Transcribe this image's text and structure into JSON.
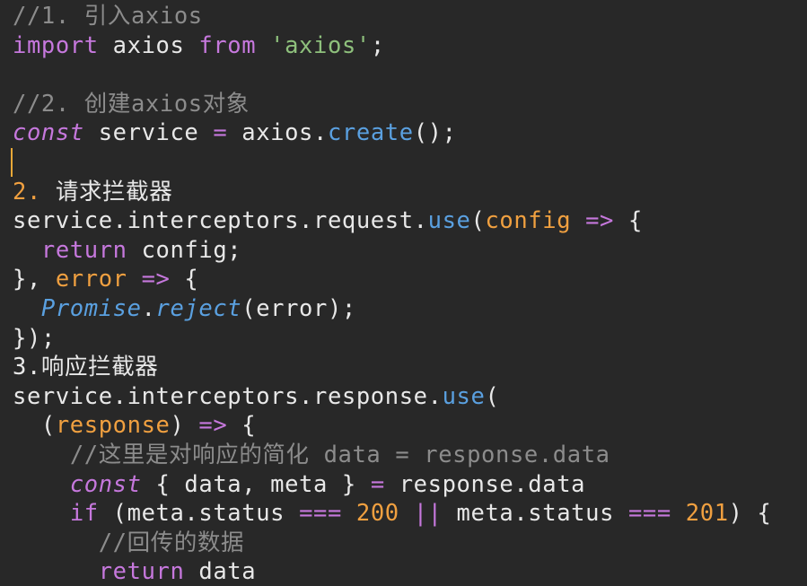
{
  "colors": {
    "background": "#282828",
    "default": "#e8e8e8",
    "comment": "#8c8c8c",
    "keyword": "#c678dd",
    "string": "#8ec07c",
    "function": "#5aa0e0",
    "orange": "#f0a040",
    "italic_keyword": "#c678dd"
  },
  "lines": [
    {
      "tokens": [
        {
          "t": "//1. 引入axios",
          "c": "comment"
        }
      ]
    },
    {
      "tokens": [
        {
          "t": "import",
          "c": "keyword"
        },
        {
          "t": " axios ",
          "c": "default"
        },
        {
          "t": "from",
          "c": "keyword"
        },
        {
          "t": " ",
          "c": "default"
        },
        {
          "t": "'axios'",
          "c": "string"
        },
        {
          "t": ";",
          "c": "default"
        }
      ]
    },
    {
      "tokens": []
    },
    {
      "tokens": [
        {
          "t": "//2. 创建axios对象",
          "c": "comment"
        }
      ]
    },
    {
      "tokens": [
        {
          "t": "const",
          "c": "italic_keyword",
          "i": true
        },
        {
          "t": " service ",
          "c": "default"
        },
        {
          "t": "=",
          "c": "keyword"
        },
        {
          "t": " axios.",
          "c": "default"
        },
        {
          "t": "create",
          "c": "function"
        },
        {
          "t": "();",
          "c": "default"
        }
      ]
    },
    {
      "tokens": []
    },
    {
      "tokens": [
        {
          "t": "2.",
          "c": "orange"
        },
        {
          "t": " 请求拦截器",
          "c": "default"
        }
      ]
    },
    {
      "tokens": [
        {
          "t": "service.interceptors.request.",
          "c": "default"
        },
        {
          "t": "use",
          "c": "function"
        },
        {
          "t": "(",
          "c": "default"
        },
        {
          "t": "config",
          "c": "orange"
        },
        {
          "t": " ",
          "c": "default"
        },
        {
          "t": "=>",
          "c": "keyword"
        },
        {
          "t": " {",
          "c": "default"
        }
      ]
    },
    {
      "tokens": [
        {
          "t": "  ",
          "c": "default"
        },
        {
          "t": "return",
          "c": "keyword"
        },
        {
          "t": " config;",
          "c": "default"
        }
      ]
    },
    {
      "tokens": [
        {
          "t": "}, ",
          "c": "default"
        },
        {
          "t": "error",
          "c": "orange"
        },
        {
          "t": " ",
          "c": "default"
        },
        {
          "t": "=>",
          "c": "keyword"
        },
        {
          "t": " {",
          "c": "default"
        }
      ]
    },
    {
      "tokens": [
        {
          "t": "  ",
          "c": "default"
        },
        {
          "t": "Promise",
          "c": "function",
          "i": true
        },
        {
          "t": ".",
          "c": "default"
        },
        {
          "t": "reject",
          "c": "function",
          "i": true
        },
        {
          "t": "(error);",
          "c": "default"
        }
      ]
    },
    {
      "tokens": [
        {
          "t": "});",
          "c": "default"
        }
      ]
    },
    {
      "tokens": [
        {
          "t": "3.响应拦截器",
          "c": "default"
        }
      ]
    },
    {
      "tokens": [
        {
          "t": "service.interceptors.response.",
          "c": "default"
        },
        {
          "t": "use",
          "c": "function"
        },
        {
          "t": "(",
          "c": "default"
        }
      ]
    },
    {
      "tokens": [
        {
          "t": "  (",
          "c": "default"
        },
        {
          "t": "response",
          "c": "orange"
        },
        {
          "t": ") ",
          "c": "default"
        },
        {
          "t": "=>",
          "c": "keyword"
        },
        {
          "t": " {",
          "c": "default"
        }
      ]
    },
    {
      "tokens": [
        {
          "t": "    ",
          "c": "default"
        },
        {
          "t": "//这里是对响应的简化 data = response.data",
          "c": "comment"
        }
      ]
    },
    {
      "tokens": [
        {
          "t": "    ",
          "c": "default"
        },
        {
          "t": "const",
          "c": "italic_keyword",
          "i": true
        },
        {
          "t": " { data, meta } ",
          "c": "default"
        },
        {
          "t": "=",
          "c": "keyword"
        },
        {
          "t": " response.data",
          "c": "default"
        }
      ]
    },
    {
      "tokens": [
        {
          "t": "    ",
          "c": "default"
        },
        {
          "t": "if",
          "c": "keyword"
        },
        {
          "t": " (meta.status ",
          "c": "default"
        },
        {
          "t": "===",
          "c": "keyword"
        },
        {
          "t": " ",
          "c": "default"
        },
        {
          "t": "200",
          "c": "orange"
        },
        {
          "t": " ",
          "c": "default"
        },
        {
          "t": "||",
          "c": "keyword"
        },
        {
          "t": " meta.status ",
          "c": "default"
        },
        {
          "t": "===",
          "c": "keyword"
        },
        {
          "t": " ",
          "c": "default"
        },
        {
          "t": "201",
          "c": "orange"
        },
        {
          "t": ") {",
          "c": "default"
        }
      ]
    },
    {
      "tokens": [
        {
          "t": "      ",
          "c": "default"
        },
        {
          "t": "//回传的数据",
          "c": "comment"
        }
      ]
    },
    {
      "tokens": [
        {
          "t": "      ",
          "c": "default"
        },
        {
          "t": "return",
          "c": "keyword"
        },
        {
          "t": " data",
          "c": "default"
        }
      ]
    }
  ]
}
